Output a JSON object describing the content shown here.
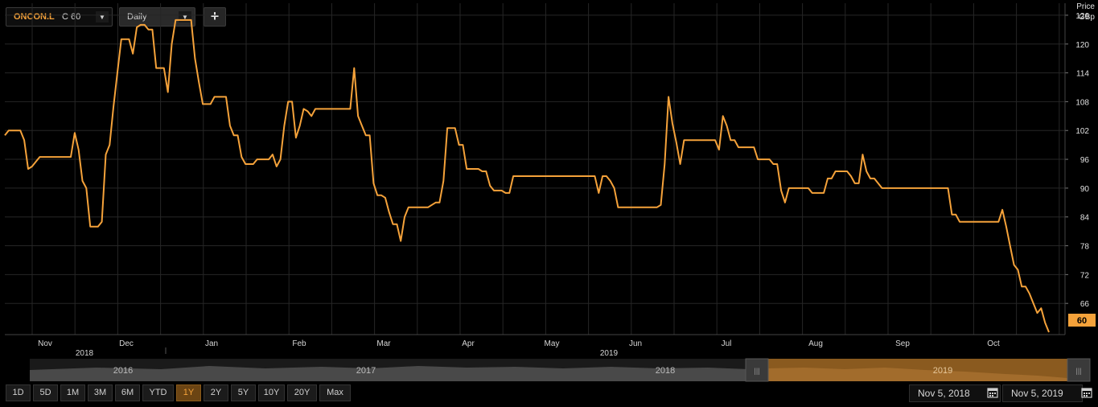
{
  "toolbar": {
    "instrument_code": "ONCON.L",
    "last_price_label": "C 60",
    "interval": "Daily",
    "add_label": "+"
  },
  "axis": {
    "unit_top": "Price",
    "unit_bottom": "GBp",
    "last_value_label": "60"
  },
  "navigator": {
    "years": [
      "2016",
      "2017",
      "2018",
      "2019"
    ],
    "handle_left": "|||",
    "handle_right": "|||"
  },
  "range_buttons": [
    "1D",
    "5D",
    "1M",
    "3M",
    "6M",
    "YTD",
    "1Y",
    "2Y",
    "5Y",
    "10Y",
    "20Y",
    "Max"
  ],
  "active_range": "1Y",
  "date_range": {
    "start": "Nov 5, 2018",
    "end": "Nov 5, 2019"
  },
  "colors": {
    "line": "#f5a23a",
    "background": "#000000",
    "grid": "#262626",
    "highlight": "#f5a23a"
  },
  "icons": {
    "interval_dropdown": "chevron-down-icon",
    "add": "plus-icon",
    "calendar": "calendar-icon"
  },
  "chart_data": {
    "type": "line",
    "series": [
      {
        "values": [
          101,
          102,
          102,
          102,
          102,
          100,
          94,
          94.5,
          95.5,
          96.5,
          96.5,
          96.5,
          96.5,
          96.5,
          96.5,
          96.5,
          96.5,
          96.5,
          101.5,
          98,
          91.5,
          90,
          82,
          82,
          82,
          83,
          97,
          99,
          107,
          114,
          121,
          121,
          121,
          118,
          123.5,
          124,
          124,
          123,
          123,
          115,
          115,
          115,
          110,
          120,
          125,
          125,
          125,
          125,
          125,
          117,
          112,
          107.5,
          107.5,
          107.5,
          109,
          109,
          109,
          109,
          103,
          101,
          101,
          96.5,
          95,
          95,
          95,
          96,
          96,
          96,
          96,
          97,
          94.5,
          96,
          103,
          108,
          108,
          100.5,
          103,
          106.5,
          106,
          105,
          106.5,
          106.5,
          106.5,
          106.5,
          106.5,
          106.5,
          106.5,
          106.5,
          106.5,
          106.5,
          115,
          105,
          103,
          101,
          101,
          91,
          88.5,
          88.5,
          88,
          85,
          82.5,
          82.5,
          79,
          84,
          86,
          86,
          86,
          86,
          86,
          86,
          86.5,
          87,
          87,
          91.5,
          102.5,
          102.5,
          102.5,
          99,
          99,
          94,
          94,
          94,
          94,
          93.5,
          93.5,
          90.5,
          89.5,
          89.5,
          89.5,
          89,
          89,
          92.5,
          92.5,
          92.5,
          92.5,
          92.5,
          92.5,
          92.5,
          92.5,
          92.5,
          92.5,
          92.5,
          92.5,
          92.5,
          92.5,
          92.5,
          92.5,
          92.5,
          92.5,
          92.5,
          92.5,
          92.5,
          92.5,
          89,
          92.5,
          92.5,
          91.5,
          90,
          86,
          86,
          86,
          86,
          86,
          86,
          86,
          86,
          86,
          86,
          86,
          86.5,
          95,
          109,
          103.5,
          99.5,
          95,
          100,
          100,
          100,
          100,
          100,
          100,
          100,
          100,
          100,
          98,
          105,
          103,
          100,
          100,
          98.5,
          98.5,
          98.5,
          98.5,
          98.5,
          96,
          96,
          96,
          96,
          95,
          95,
          89.5,
          87,
          90,
          90,
          90,
          90,
          90,
          90,
          89,
          89,
          89,
          89,
          92,
          92,
          93.5,
          93.5,
          93.5,
          93.5,
          92.5,
          91,
          91,
          97,
          93.5,
          92,
          92,
          91,
          90,
          90,
          90,
          90,
          90,
          90,
          90,
          90,
          90,
          90,
          90,
          90,
          90,
          90,
          90,
          90,
          90,
          90,
          84.5,
          84.5,
          83,
          83,
          83,
          83,
          83,
          83,
          83,
          83,
          83,
          83,
          83,
          85.5,
          82,
          78,
          74,
          73,
          69.5,
          69.5,
          68,
          66,
          64,
          65,
          62,
          60
        ]
      }
    ],
    "x_tick_labels": [
      "Nov",
      "Dec",
      "Jan",
      "Feb",
      "Mar",
      "Apr",
      "May",
      "Jun",
      "Jul",
      "Aug",
      "Sep",
      "Oct"
    ],
    "x_year_labels": [
      "2018",
      "2019"
    ],
    "y_ticks": [
      66,
      72,
      78,
      84,
      90,
      96,
      102,
      108,
      114,
      120,
      126
    ],
    "ylim": [
      59.5,
      128.5
    ],
    "grid": true,
    "y_axis_side": "right"
  }
}
